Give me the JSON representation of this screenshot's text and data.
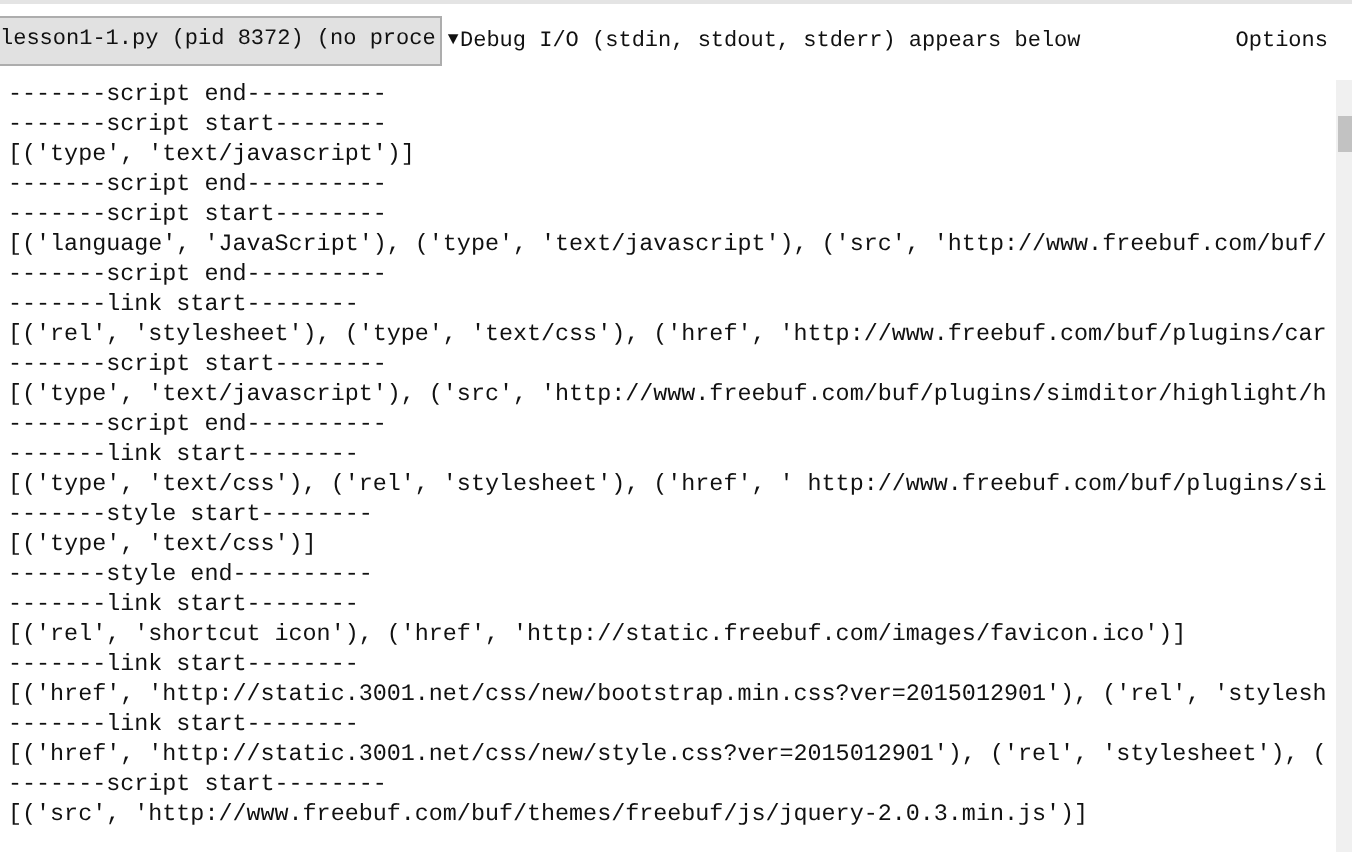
{
  "toolbar": {
    "process_select": {
      "value": "lesson1-1.py (pid 8372) (no proce",
      "caret": "▼"
    },
    "info": "Debug I/O (stdin, stdout, stderr) appears below",
    "options": "Options"
  },
  "output_lines": [
    "-------script end----------",
    "-------script start--------",
    "[('type', 'text/javascript')]",
    "-------script end----------",
    "-------script start--------",
    "[('language', 'JavaScript'), ('type', 'text/javascript'), ('src', 'http://www.freebuf.com/buf/",
    "-------script end----------",
    "-------link start--------",
    "[('rel', 'stylesheet'), ('type', 'text/css'), ('href', 'http://www.freebuf.com/buf/plugins/car",
    "-------script start--------",
    "[('type', 'text/javascript'), ('src', 'http://www.freebuf.com/buf/plugins/simditor/highlight/h",
    "-------script end----------",
    "-------link start--------",
    "[('type', 'text/css'), ('rel', 'stylesheet'), ('href', ' http://www.freebuf.com/buf/plugins/si",
    "-------style start--------",
    "[('type', 'text/css')]",
    "-------style end----------",
    "-------link start--------",
    "[('rel', 'shortcut icon'), ('href', 'http://static.freebuf.com/images/favicon.ico')]",
    "-------link start--------",
    "[('href', 'http://static.3001.net/css/new/bootstrap.min.css?ver=2015012901'), ('rel', 'stylesh",
    "-------link start--------",
    "[('href', 'http://static.3001.net/css/new/style.css?ver=2015012901'), ('rel', 'stylesheet'), (",
    "-------script start--------",
    "[('src', 'http://www.freebuf.com/buf/themes/freebuf/js/jquery-2.0.3.min.js')]"
  ]
}
